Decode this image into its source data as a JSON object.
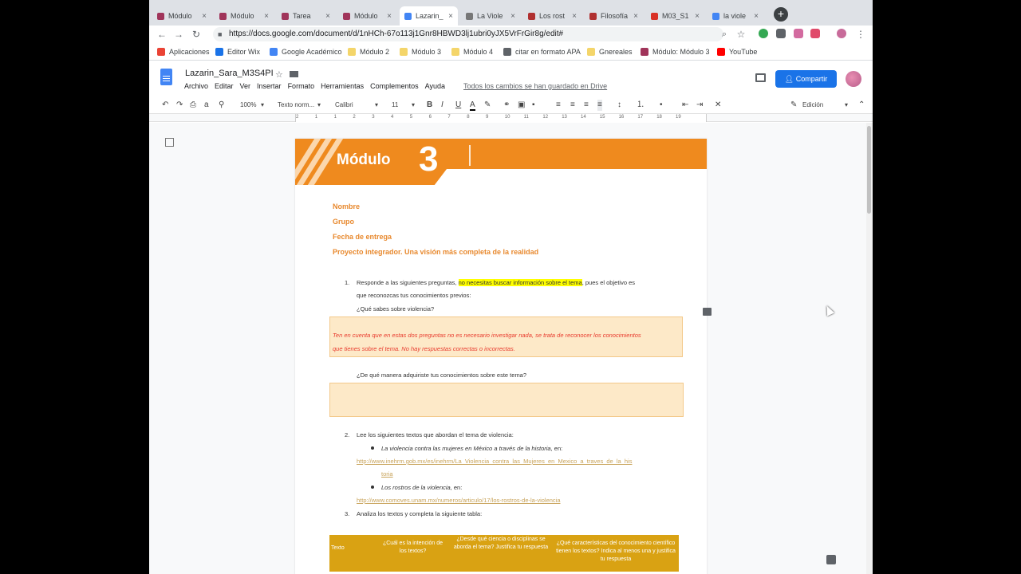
{
  "browser": {
    "tabs": [
      {
        "label": "Módulo",
        "favicon_color": "#a0345a"
      },
      {
        "label": "Módulo",
        "favicon_color": "#a0345a"
      },
      {
        "label": "Tarea",
        "favicon_color": "#a0345a"
      },
      {
        "label": "Módulo",
        "favicon_color": "#a0345a"
      },
      {
        "label": "Lazarin_",
        "favicon_color": "#4285f4"
      },
      {
        "label": "La Viole",
        "favicon_color": "#777777"
      },
      {
        "label": "Los rost",
        "favicon_color": "#b03030"
      },
      {
        "label": "Filosofía",
        "favicon_color": "#b03030"
      },
      {
        "label": "M03_S1",
        "favicon_color": "#d93025"
      },
      {
        "label": "la viole",
        "favicon_color": "#4285f4"
      }
    ],
    "tab_close": "×",
    "new_tab": "+",
    "url": "https://docs.google.com/document/d/1nHCh-67o113j1Gnr8HBWD3lj1ubri0yJX5VrFrGir8g/edit#",
    "bookmarks": [
      {
        "label": "Aplicaciones",
        "icon_color": "#ea4335"
      },
      {
        "label": "Editor Wix",
        "icon_color": "#1a73e8"
      },
      {
        "label": "Google Académico",
        "icon_color": "#4285f4"
      },
      {
        "label": "Módulo 2",
        "icon_color": "#f4d56a"
      },
      {
        "label": "Módulo 3",
        "icon_color": "#f4d56a"
      },
      {
        "label": "Módulo 4",
        "icon_color": "#f4d56a"
      },
      {
        "label": "citar en formato APA",
        "icon_color": "#5f6368"
      },
      {
        "label": "Gnereales",
        "icon_color": "#f4d56a"
      },
      {
        "label": "Módulo: Módulo 3",
        "icon_color": "#a0345a"
      },
      {
        "label": "YouTube",
        "icon_color": "#ff0000"
      }
    ]
  },
  "docs": {
    "title": "Lazarin_Sara_M3S4PI",
    "menu": [
      "Archivo",
      "Editar",
      "Ver",
      "Insertar",
      "Formato",
      "Herramientas",
      "Complementos",
      "Ayuda"
    ],
    "save_status": "Todos los cambios se han guardado en Drive",
    "share_label": "Compartir",
    "toolbar": {
      "zoom": "100%",
      "style": "Texto norm...",
      "font": "Calibri",
      "size": "11",
      "mode": "Edición"
    },
    "ruler_numbers": [
      "2",
      "1",
      "1",
      "2",
      "3",
      "4",
      "5",
      "6",
      "7",
      "8",
      "9",
      "10",
      "11",
      "12",
      "13",
      "14",
      "15",
      "16",
      "17",
      "18",
      "19"
    ]
  },
  "document": {
    "banner_word": "Módulo",
    "banner_number": "3",
    "fields": [
      "Nombre",
      "Grupo",
      "Fecha de entrega",
      "Proyecto integrador. Una visión más completa de la realidad"
    ],
    "q1": {
      "number": "1.",
      "text_before": "Responde a las siguientes preguntas,",
      "highlight": "no necesitas buscar información sobre el tema",
      "text_after": ", pues el objetivo es",
      "line2": "que reconozcas tus conocimientos previos:",
      "question_a": "¿Qué sabes sobre violencia?",
      "note_line1": "Ten en cuenta que en estas dos preguntas no es necesario investigar nada, se trata de reconocer los conocimientos",
      "note_line2": "que tienes sobre el tema. No hay respuestas correctas o incorrectas.",
      "question_b": "¿De qué manera adquiriste tus conocimientos sobre este tema?"
    },
    "q2": {
      "number": "2.",
      "text": "Lee los siguientes textos que abordan el tema de violencia:",
      "item1_title": "La violencia contra las mujeres en México a través de la historia,",
      "item1_suffix": "en:",
      "item1_link_a": "http://www.inehrm.gob.mx/es/inehrm/La_Violencia_contra_las_Mujeres_en_Mexico_a_traves_de_la_his",
      "item1_link_b": "toria",
      "item2_title": "Los rostros de la violencia,",
      "item2_suffix": "en:",
      "item2_link": "http://www.comoves.unam.mx/numeros/articulo/17/los-rostros-de-la-violencia"
    },
    "q3": {
      "number": "3.",
      "text": "Analiza los textos y completa la siguiente tabla:"
    },
    "table_headers": [
      "Texto",
      "¿Cuál es la intención de los textos?",
      "¿Desde qué ciencia o disciplinas se aborda el tema? Justifica tu respuesta",
      "¿Qué características del conocimiento científico tienen los textos? Indica al menos una y justifica tu respuesta"
    ]
  }
}
